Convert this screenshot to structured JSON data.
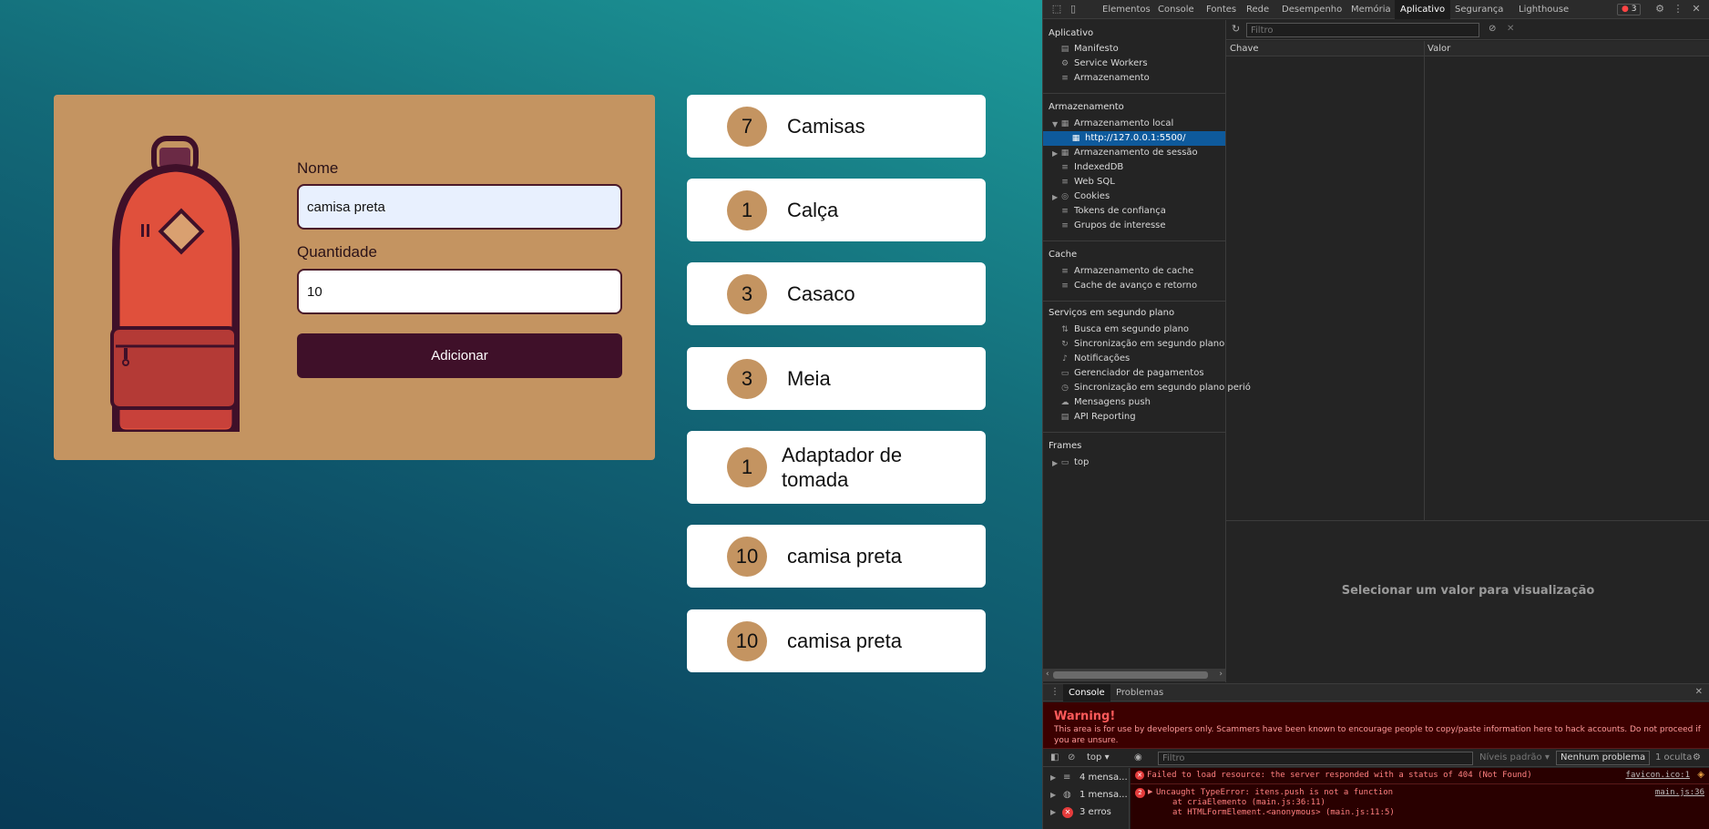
{
  "form": {
    "nome_label": "Nome",
    "nome_value": "camisa preta",
    "quantidade_label": "Quantidade",
    "quantidade_value": "10",
    "submit_label": "Adicionar"
  },
  "items": [
    {
      "qty": "7",
      "name": "Camisas"
    },
    {
      "qty": "1",
      "name": "Calça"
    },
    {
      "qty": "3",
      "name": "Casaco"
    },
    {
      "qty": "3",
      "name": "Meia"
    },
    {
      "qty": "1",
      "name": "Adaptador de tomada"
    },
    {
      "qty": "10",
      "name": "camisa preta"
    },
    {
      "qty": "10",
      "name": "camisa preta"
    }
  ],
  "colors": {
    "card": "#c49461",
    "button": "#3f1029",
    "qty_badge": "#c49461",
    "bag": "#e0503c"
  },
  "devtools": {
    "tabs": [
      "Elementos",
      "Console",
      "Fontes",
      "Rede",
      "Desempenho",
      "Memória",
      "Aplicativo",
      "Segurança",
      "Lighthouse"
    ],
    "active_tab": "Aplicativo",
    "error_badge": "3",
    "sidebar": {
      "app_header": "Aplicativo",
      "app_items": [
        "Manifesto",
        "Service Workers",
        "Armazenamento"
      ],
      "storage_header": "Armazenamento",
      "local_storage": "Armazenamento local",
      "local_origin": "http://127.0.0.1:5500/",
      "storage_items": [
        "Armazenamento de sessão",
        "IndexedDB",
        "Web SQL",
        "Cookies",
        "Tokens de confiança",
        "Grupos de interesse"
      ],
      "cache_header": "Cache",
      "cache_items": [
        "Armazenamento de cache",
        "Cache de avanço e retorno"
      ],
      "bg_header": "Serviços em segundo plano",
      "bg_items": [
        "Busca em segundo plano",
        "Sincronização em segundo plano",
        "Notificações",
        "Gerenciador de pagamentos",
        "Sincronização em segundo plano perió",
        "Mensagens push",
        "API Reporting"
      ],
      "frames_header": "Frames",
      "frames_items": [
        "top"
      ]
    },
    "filter_placeholder": "Filtro",
    "col_key": "Chave",
    "col_value": "Valor",
    "preview_text": "Selecionar um valor para visualização",
    "drawer_tabs": [
      "Console",
      "Problemas"
    ],
    "warning_title": "Warning!",
    "warning_text": "This area is for use by developers only. Scammers have been known to encourage people to copy/paste information here to hack accounts. Do not proceed if you are unsure.",
    "context": "top",
    "console_filter": "Filtro",
    "levels": "Níveis padrão",
    "no_issues": "Nenhum problema",
    "hidden": "1 oculta",
    "groups": [
      "4 mensa...",
      "1 mensa...",
      "3 erros"
    ],
    "messages": [
      {
        "text": "Failed to load resource: the server responded with a status of 404 (Not Found)",
        "source": "favicon.ico:1"
      },
      {
        "count": "2",
        "text": "Uncaught TypeError: itens.push is not a function",
        "source": "main.js:36",
        "stack": [
          "at criaElemento (main.js:36:11)",
          "at HTMLFormElement.<anonymous> (main.js:11:5)"
        ]
      }
    ]
  }
}
